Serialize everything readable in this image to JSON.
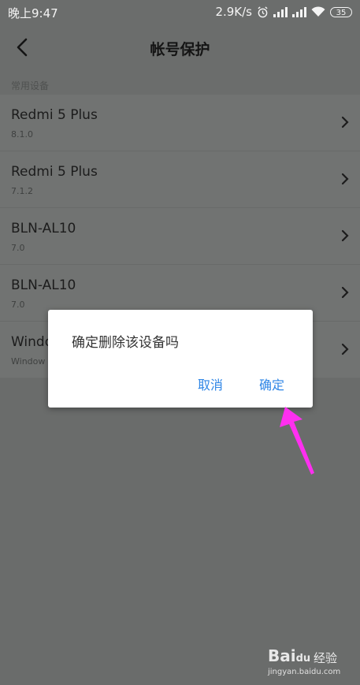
{
  "status_bar": {
    "time": "晚上9:47",
    "network_speed": "2.9K/s",
    "battery": "35",
    "icons": [
      "alarm-icon",
      "signal-icon",
      "signal-icon",
      "wifi-icon",
      "battery-icon"
    ]
  },
  "header": {
    "title": "帐号保护",
    "back_icon": "chevron-left-icon"
  },
  "section": {
    "label": "常用设备"
  },
  "devices": [
    {
      "name": "Redmi 5 Plus",
      "version": "8.1.0"
    },
    {
      "name": "Redmi 5 Plus",
      "version": "7.1.2"
    },
    {
      "name": "BLN-AL10",
      "version": "7.0"
    },
    {
      "name": "BLN-AL10",
      "version": "7.0"
    },
    {
      "name": "Windo",
      "version": "Window"
    }
  ],
  "dialog": {
    "message": "确定删除该设备吗",
    "cancel_label": "取消",
    "confirm_label": "确定"
  },
  "colors": {
    "accent": "#2f86e6",
    "arrow": "#ff2ff0",
    "overlay_bg": "#6b6d6c"
  },
  "watermark": {
    "logo": "Bai",
    "logo_du": "du",
    "brand_cn": "经验",
    "url": "jingyan.baidu.com"
  }
}
